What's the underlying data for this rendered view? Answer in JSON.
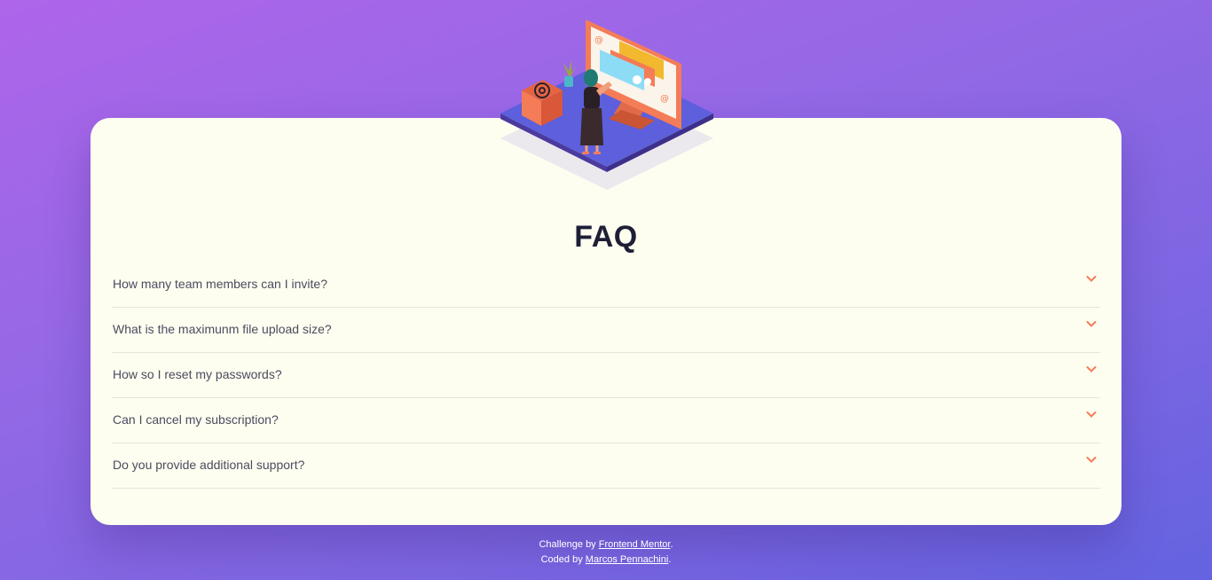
{
  "title": "FAQ",
  "faq": {
    "items": [
      {
        "question": "How many team members can I invite?"
      },
      {
        "question": "What is the maximunm file upload size?"
      },
      {
        "question": "How so I reset my passwords?"
      },
      {
        "question": "Can I cancel my subscription?"
      },
      {
        "question": "Do you provide additional support?"
      }
    ],
    "expand_icon": "chevron-down-icon"
  },
  "footer": {
    "line1_prefix": "Challenge by ",
    "line1_link": "Frontend Mentor",
    "line1_suffix": ".",
    "line2_prefix": "Coded by ",
    "line2_link": "Marcos Pennachini",
    "line2_suffix": "."
  },
  "colors": {
    "background_start": "#ae65ea",
    "background_end": "#6463e0",
    "card": "#fdfdf0",
    "heading": "#1e1f36",
    "question_text": "#4b4c5f",
    "accent": "#f47c57",
    "divider": "#e6e6dc"
  }
}
